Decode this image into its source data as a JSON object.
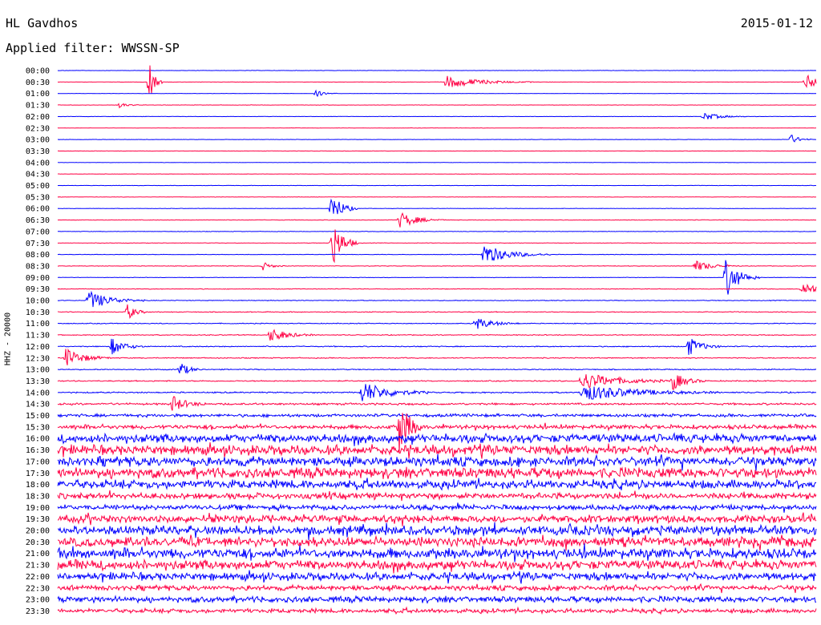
{
  "header": {
    "station": "HL Gavdhos",
    "date": "2015-01-12",
    "filter": "Applied filter: WWSSN-SP"
  },
  "chart_data": {
    "type": "line",
    "title": "HL Gavdhos",
    "subtitle": "Applied filter: WWSSN-SP",
    "ylabel": "HHZ - 20000",
    "date": "2015-01-12",
    "row_labels": [
      "00:00",
      "00:30",
      "01:00",
      "01:30",
      "02:00",
      "02:30",
      "03:00",
      "03:30",
      "04:00",
      "04:30",
      "05:00",
      "05:30",
      "06:00",
      "06:30",
      "07:00",
      "07:30",
      "08:00",
      "08:30",
      "09:00",
      "09:30",
      "10:00",
      "10:30",
      "11:00",
      "11:30",
      "12:00",
      "12:30",
      "13:00",
      "13:30",
      "14:00",
      "14:30",
      "15:00",
      "15:30",
      "16:00",
      "16:30",
      "17:00",
      "17:30",
      "18:00",
      "18:30",
      "19:00",
      "19:30",
      "20:00",
      "20:30",
      "21:00",
      "21:30",
      "22:00",
      "22:30",
      "23:00",
      "23:30"
    ],
    "trace_colors": [
      "#0000ff",
      "#ff0044"
    ],
    "noise_level": [
      0.02,
      0.02,
      0.02,
      0.02,
      0.02,
      0.02,
      0.02,
      0.02,
      0.02,
      0.02,
      0.02,
      0.02,
      0.025,
      0.03,
      0.03,
      0.03,
      0.03,
      0.03,
      0.03,
      0.04,
      0.04,
      0.05,
      0.05,
      0.05,
      0.06,
      0.06,
      0.06,
      0.07,
      0.08,
      0.12,
      0.18,
      0.25,
      0.5,
      0.55,
      0.55,
      0.6,
      0.5,
      0.35,
      0.3,
      0.45,
      0.55,
      0.55,
      0.6,
      0.55,
      0.45,
      0.3,
      0.35,
      0.25
    ],
    "events": [
      {
        "row": 1,
        "x": 0.12,
        "amp": 3.0,
        "dur": 0.006
      },
      {
        "row": 1,
        "x": 0.51,
        "amp": 0.9,
        "dur": 0.04
      },
      {
        "row": 1,
        "x": 0.985,
        "amp": 1.0,
        "dur": 0.03
      },
      {
        "row": 2,
        "x": 0.34,
        "amp": 0.5,
        "dur": 0.01
      },
      {
        "row": 3,
        "x": 0.08,
        "amp": 0.4,
        "dur": 0.01
      },
      {
        "row": 4,
        "x": 0.85,
        "amp": 0.6,
        "dur": 0.02
      },
      {
        "row": 6,
        "x": 0.965,
        "amp": 0.8,
        "dur": 0.01
      },
      {
        "row": 12,
        "x": 0.36,
        "amp": 2.5,
        "dur": 0.012
      },
      {
        "row": 13,
        "x": 0.45,
        "amp": 1.2,
        "dur": 0.02
      },
      {
        "row": 15,
        "x": 0.36,
        "amp": 4.0,
        "dur": 0.012
      },
      {
        "row": 16,
        "x": 0.56,
        "amp": 1.5,
        "dur": 0.03
      },
      {
        "row": 17,
        "x": 0.84,
        "amp": 0.8,
        "dur": 0.02
      },
      {
        "row": 17,
        "x": 0.27,
        "amp": 0.6,
        "dur": 0.01
      },
      {
        "row": 18,
        "x": 0.88,
        "amp": 3.0,
        "dur": 0.015
      },
      {
        "row": 19,
        "x": 0.98,
        "amp": 0.9,
        "dur": 0.03
      },
      {
        "row": 20,
        "x": 0.04,
        "amp": 1.4,
        "dur": 0.025
      },
      {
        "row": 21,
        "x": 0.09,
        "amp": 1.3,
        "dur": 0.01
      },
      {
        "row": 22,
        "x": 0.55,
        "amp": 0.9,
        "dur": 0.02
      },
      {
        "row": 23,
        "x": 0.28,
        "amp": 1.0,
        "dur": 0.02
      },
      {
        "row": 24,
        "x": 0.07,
        "amp": 1.3,
        "dur": 0.015
      },
      {
        "row": 24,
        "x": 0.83,
        "amp": 1.5,
        "dur": 0.015
      },
      {
        "row": 25,
        "x": 0.01,
        "amp": 1.4,
        "dur": 0.02
      },
      {
        "row": 26,
        "x": 0.16,
        "amp": 1.2,
        "dur": 0.01
      },
      {
        "row": 27,
        "x": 0.69,
        "amp": 1.3,
        "dur": 0.04
      },
      {
        "row": 27,
        "x": 0.81,
        "amp": 1.4,
        "dur": 0.015
      },
      {
        "row": 28,
        "x": 0.4,
        "amp": 1.6,
        "dur": 0.03
      },
      {
        "row": 28,
        "x": 0.69,
        "amp": 1.2,
        "dur": 0.06
      },
      {
        "row": 29,
        "x": 0.15,
        "amp": 1.2,
        "dur": 0.015
      },
      {
        "row": 31,
        "x": 0.45,
        "amp": 5.0,
        "dur": 0.01
      }
    ]
  }
}
